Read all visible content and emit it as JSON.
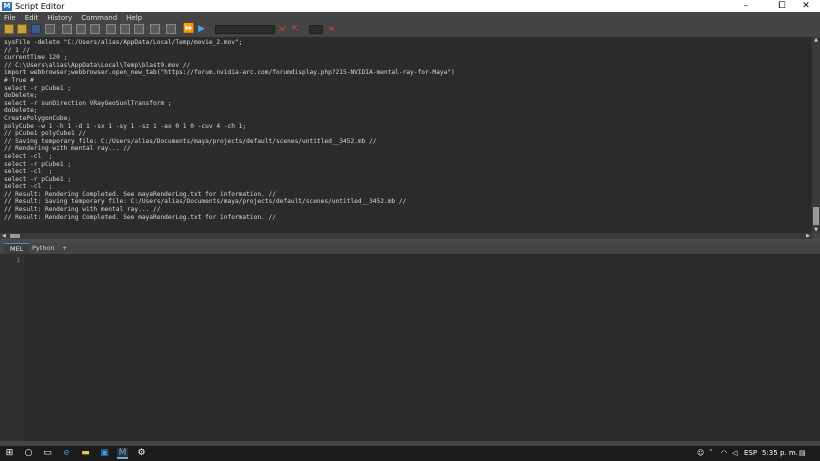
{
  "window": {
    "title": "Script Editor",
    "app_icon": "M",
    "minimize": "–",
    "maximize": "⧠",
    "close": "✕"
  },
  "menu": [
    "File",
    "Edit",
    "History",
    "Command",
    "Help"
  ],
  "history_lines": [
    "sysFile -delete \"C:/Users/alias/AppData/Local/Temp/movie_2.mov\";",
    "// 1 //",
    "currentTime 120 ;",
    "// C:\\Users\\alias\\AppData\\Local\\Temp\\blast9.mov //",
    "import webbrowser;webbrowser.open_new_tab(\"https://forum.nvidia-arc.com/forumdisplay.php?215-NVIDIA-mental-ray-for-Maya\")",
    "# True #",
    "select -r pCube1 ;",
    "doDelete;",
    "select -r sunDirection VRayGeoSunlTransform ;",
    "doDelete;",
    "CreatePolygonCube;",
    "polyCube -w 1 -h 1 -d 1 -sx 1 -sy 1 -sz 1 -ax 0 1 0 -cuv 4 -ch 1;",
    "// pCube1 polyCube1 //",
    "// Saving temporary file: C:/Users/alias/Documents/maya/projects/default/scenes/untitled__3452.mb //",
    "// Rendering with mental ray... //",
    "select -cl  ;",
    "select -r pCube1 ;",
    "select -cl  ;",
    "select -r pCube1 ;",
    "select -cl  ;",
    "// Result: Rendering Completed. See mayaRenderLog.txt for information. //",
    "// Result: Saving temporary file: C:/Users/alias/Documents/maya/projects/default/scenes/untitled__3452.mb //",
    "// Result: Rendering with mental ray... //",
    "// Result: Rendering Completed. See mayaRenderLog.txt for information. //"
  ],
  "tabs": [
    "MEL",
    "Python",
    "+"
  ],
  "input": {
    "line_number": "1"
  },
  "taskbar": {
    "lang": "ESP",
    "time": "5:35 p. m."
  }
}
